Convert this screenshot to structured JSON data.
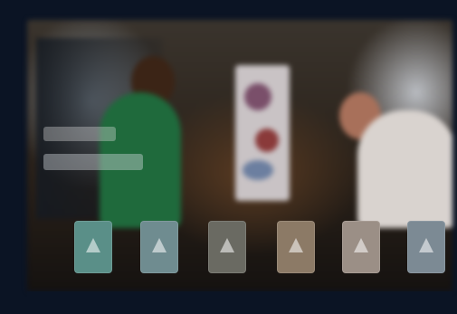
{
  "media": {
    "tiles": [
      {
        "icon": "app-tile-icon"
      },
      {
        "icon": "app-tile-icon"
      },
      {
        "icon": "app-tile-icon"
      },
      {
        "icon": "app-tile-icon"
      },
      {
        "icon": "app-tile-icon"
      },
      {
        "icon": "app-tile-icon"
      }
    ]
  },
  "colors": {
    "frame": "#0b1424",
    "accent_green": "#1f6a3c",
    "tile_teal": "#5a8f88"
  }
}
